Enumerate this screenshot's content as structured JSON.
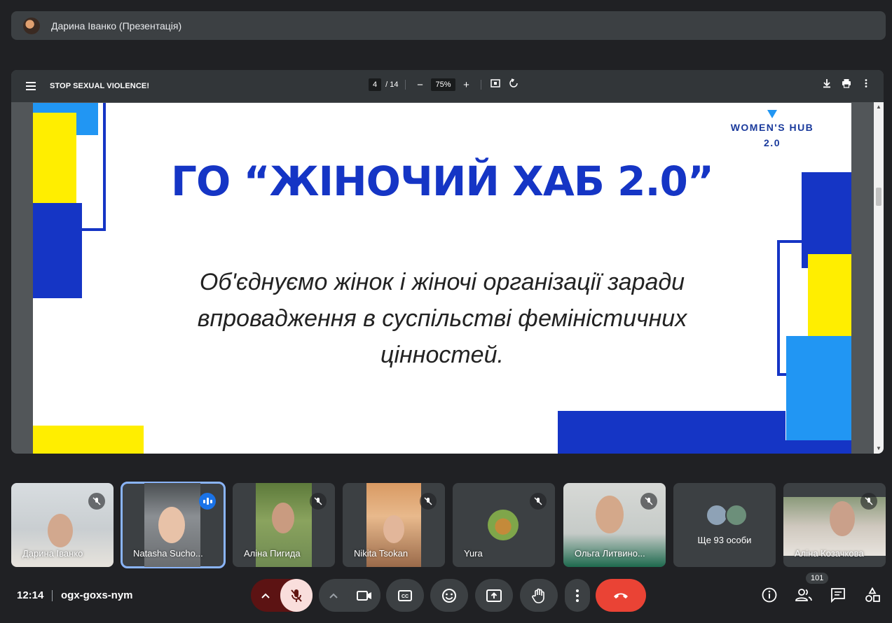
{
  "header": {
    "presenter_label": "Дарина Іванко (Презентація)"
  },
  "pdf": {
    "title": "STOP SEXUAL VIOLENCE!",
    "page_current": "4",
    "page_total": "/ 14",
    "zoom": "75%"
  },
  "slide": {
    "title": "ГО “ЖІНОЧИЙ ХАБ 2.0”",
    "body_line1": "Об'єднуємо жінок і жіночі організації заради",
    "body_line2": "впровадження в суспільстві феміністичних",
    "body_line3": "цінностей.",
    "logo_line1": "WOMEN'S HUB",
    "logo_line2": "2.0",
    "colors": {
      "blue": "#1535c5",
      "light_blue": "#2196f3",
      "yellow": "#ffee00"
    }
  },
  "participants": [
    {
      "name": "Дарина Іванко",
      "muted": true
    },
    {
      "name": "Natasha Sucho...",
      "muted": false,
      "speaking": true
    },
    {
      "name": "Аліна Пигида",
      "muted": true
    },
    {
      "name": "Nikita Tsokan",
      "muted": true
    },
    {
      "name": "Yura",
      "muted": true,
      "icon": "dog-avatar"
    },
    {
      "name": "Ольга Литвино...",
      "muted": true
    },
    {
      "name": "Аліна Козачкова",
      "muted": true
    }
  ],
  "more_participants_label": "Ще 93 особи",
  "bottom": {
    "time": "12:14",
    "meeting_code": "ogx-goxs-nym",
    "participant_count": "101",
    "end_call_color": "#ea4335",
    "mic_off_color": "#f9dedc"
  }
}
